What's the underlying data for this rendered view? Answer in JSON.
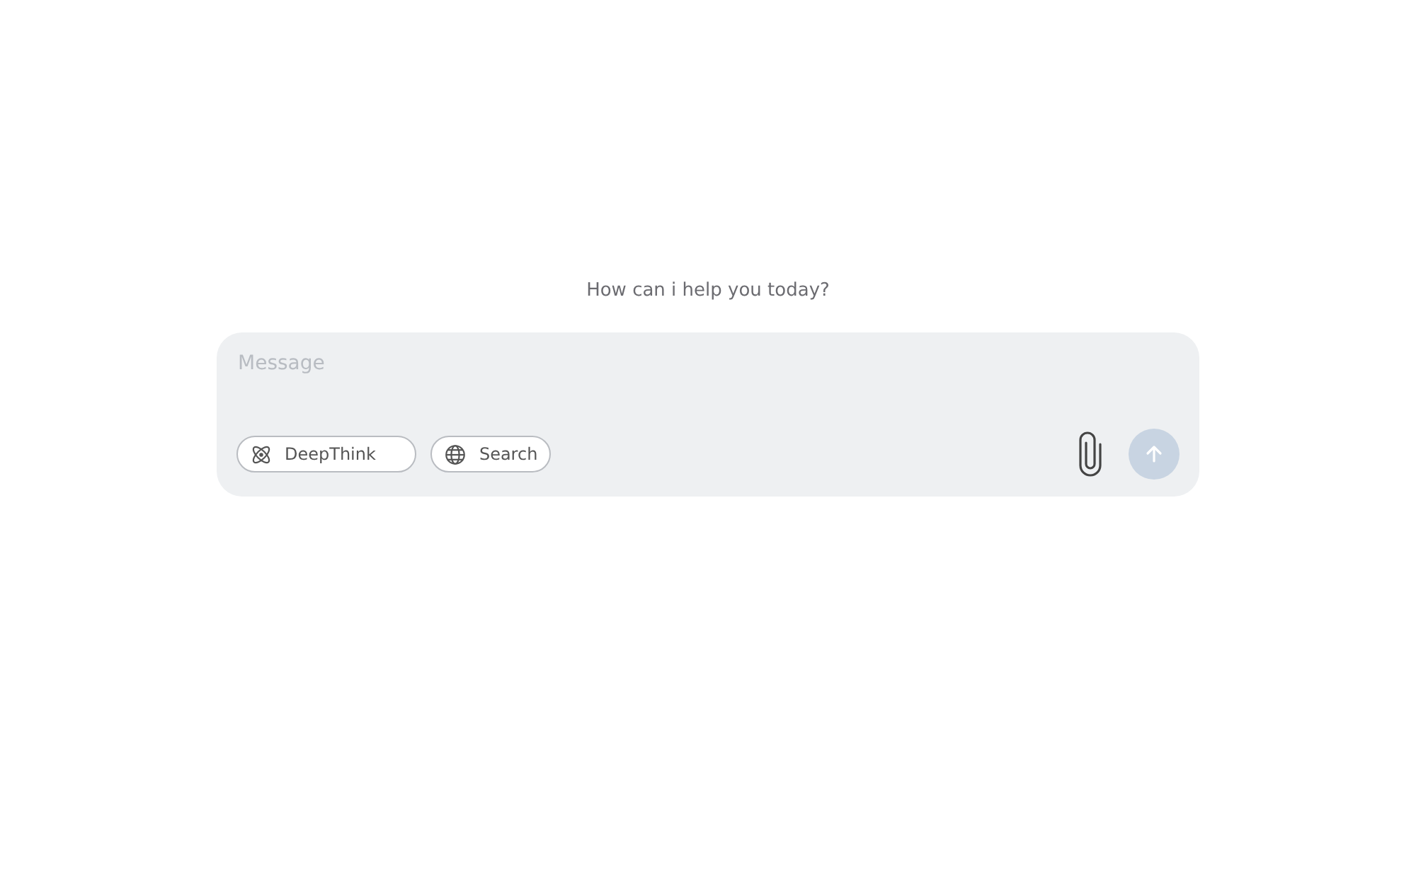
{
  "greeting": "How can i help you today?",
  "composer": {
    "placeholder": "Message",
    "toggles": [
      {
        "kind": "deepthink",
        "label": "DeepThink",
        "selected": false
      },
      {
        "kind": "search",
        "label": "Search",
        "selected": false
      }
    ],
    "send": {
      "disabled": true
    }
  }
}
